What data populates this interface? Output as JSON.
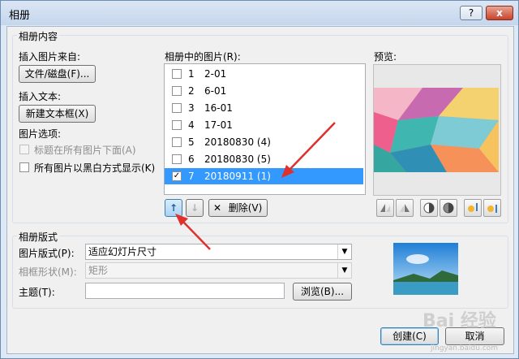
{
  "window": {
    "title": "相册",
    "help": "?",
    "close": "x"
  },
  "album_content": {
    "group_label": "相册内容",
    "insert_from": "插入图片来自:",
    "file_disk_button": "文件/磁盘(F)...",
    "insert_text": "插入文本:",
    "new_textbox_button": "新建文本框(X)",
    "picture_options": "图片选项:",
    "caption_below": "标题在所有图片下面(A)",
    "all_bw": "所有图片以黑白方式显示(K)",
    "pictures_label": "相册中的图片(R):",
    "preview_label": "预览:",
    "pictures": [
      {
        "num": "1",
        "name": "2-01",
        "checked": false,
        "selected": false
      },
      {
        "num": "2",
        "name": "6-01",
        "checked": false,
        "selected": false
      },
      {
        "num": "3",
        "name": "16-01",
        "checked": false,
        "selected": false
      },
      {
        "num": "4",
        "name": "17-01",
        "checked": false,
        "selected": false
      },
      {
        "num": "5",
        "name": "20180830 (4)",
        "checked": false,
        "selected": false
      },
      {
        "num": "6",
        "name": "20180830 (5)",
        "checked": false,
        "selected": false
      },
      {
        "num": "7",
        "name": "20180911 (1)",
        "checked": true,
        "selected": true
      }
    ],
    "move_up": "↑",
    "move_down": "↓",
    "delete_button": "删除(V)",
    "check_mark": "✓"
  },
  "album_layout": {
    "group_label": "相册版式",
    "picture_layout_label": "图片版式(P):",
    "picture_layout_value": "适应幻灯片尺寸",
    "frame_shape_label": "相框形状(M):",
    "frame_shape_value": "矩形",
    "theme_label": "主题(T):",
    "theme_value": "",
    "browse_button": "浏览(B)..."
  },
  "footer": {
    "create_button": "创建(C)",
    "cancel_button": "取消"
  },
  "watermark": {
    "text": "Bai 经验",
    "sub": "jingyan.baidu.com"
  },
  "colors": {
    "selection": "#3399ff",
    "annotation_arrow": "#e0302b"
  }
}
